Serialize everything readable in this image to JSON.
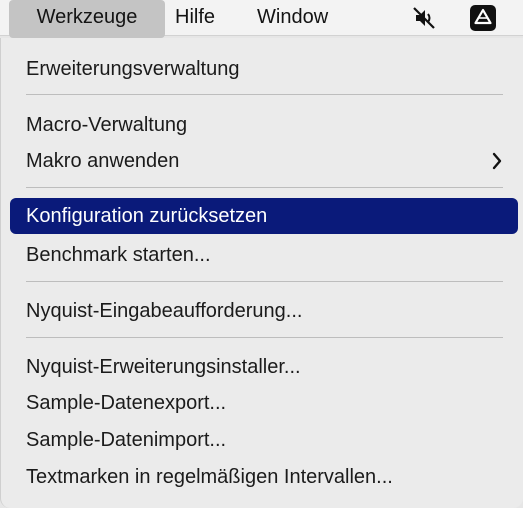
{
  "menubar": {
    "items": [
      {
        "label": "Werkzeuge",
        "active": true
      },
      {
        "label": "Hilfe"
      },
      {
        "label": "Window"
      }
    ],
    "status_icons": [
      "mute-icon",
      "google-drive-icon"
    ]
  },
  "menu": {
    "highlight_color": "#0a1a7a",
    "items": [
      {
        "label": "Erweiterungsverwaltung"
      },
      {
        "label": "Macro-Verwaltung"
      },
      {
        "label": "Makro anwenden",
        "submenu": true
      },
      {
        "label": "Konfiguration zurücksetzen",
        "highlighted": true
      },
      {
        "label": "Benchmark starten..."
      },
      {
        "label": "Nyquist-Eingabeaufforderung..."
      },
      {
        "label": "Nyquist-Erweiterungsinstaller..."
      },
      {
        "label": "Sample-Datenexport..."
      },
      {
        "label": "Sample-Datenimport..."
      },
      {
        "label": "Textmarken in regelmäßigen Intervallen..."
      }
    ]
  }
}
